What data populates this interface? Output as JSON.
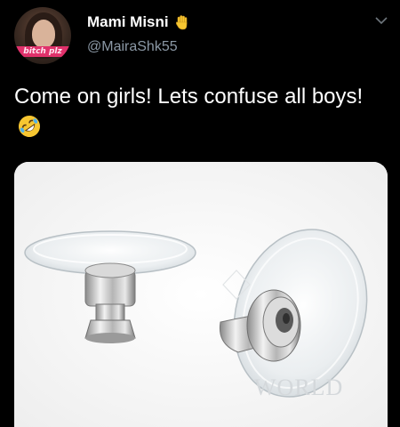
{
  "tweet": {
    "avatar_caption": "bitch plz",
    "display_name": "Mami Misni",
    "name_emoji_icon": "waving-hand-icon",
    "handle": "@MairaShk55",
    "text": "Come on girls! Lets confuse all boys!",
    "text_emoji_icon": "rolling-on-floor-laughing-icon",
    "menu_icon": "chevron-down-icon",
    "media_watermark": "WORLD"
  },
  "colors": {
    "background": "#000000",
    "primary_text": "#ffffff",
    "secondary_text": "#8b98a5",
    "emoji_yellow": "#f7c631"
  }
}
